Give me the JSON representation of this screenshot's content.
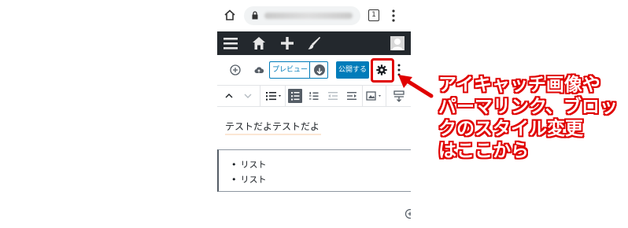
{
  "browser": {
    "tab_count": "1"
  },
  "editor": {
    "preview_label": "プレビュー",
    "publish_label": "公開する"
  },
  "content": {
    "paragraph": "テストだよテストだよ",
    "list_items": [
      "リスト",
      "リスト"
    ]
  },
  "annotation": {
    "lines": [
      "アイキャッチ画像や",
      "パーマリンク、ブロッ",
      "クのスタイル変更",
      "はここから"
    ]
  },
  "colors": {
    "admin_bar": "#23282d",
    "primary": "#007cba",
    "annotation_red": "#e00000"
  },
  "icons": [
    "home-icon",
    "lock-icon",
    "more-vertical-icon",
    "menu-icon",
    "house-icon",
    "plus-icon",
    "brush-icon",
    "avatar",
    "add-block-icon",
    "cloud-upload-icon",
    "external-link-icon",
    "gear-icon",
    "chevron-up-icon",
    "chevron-down-icon",
    "list-icon",
    "unordered-list-icon",
    "ordered-list-icon",
    "outdent-icon",
    "indent-icon",
    "media-icon",
    "insert-below-icon",
    "add-circle-icon"
  ]
}
